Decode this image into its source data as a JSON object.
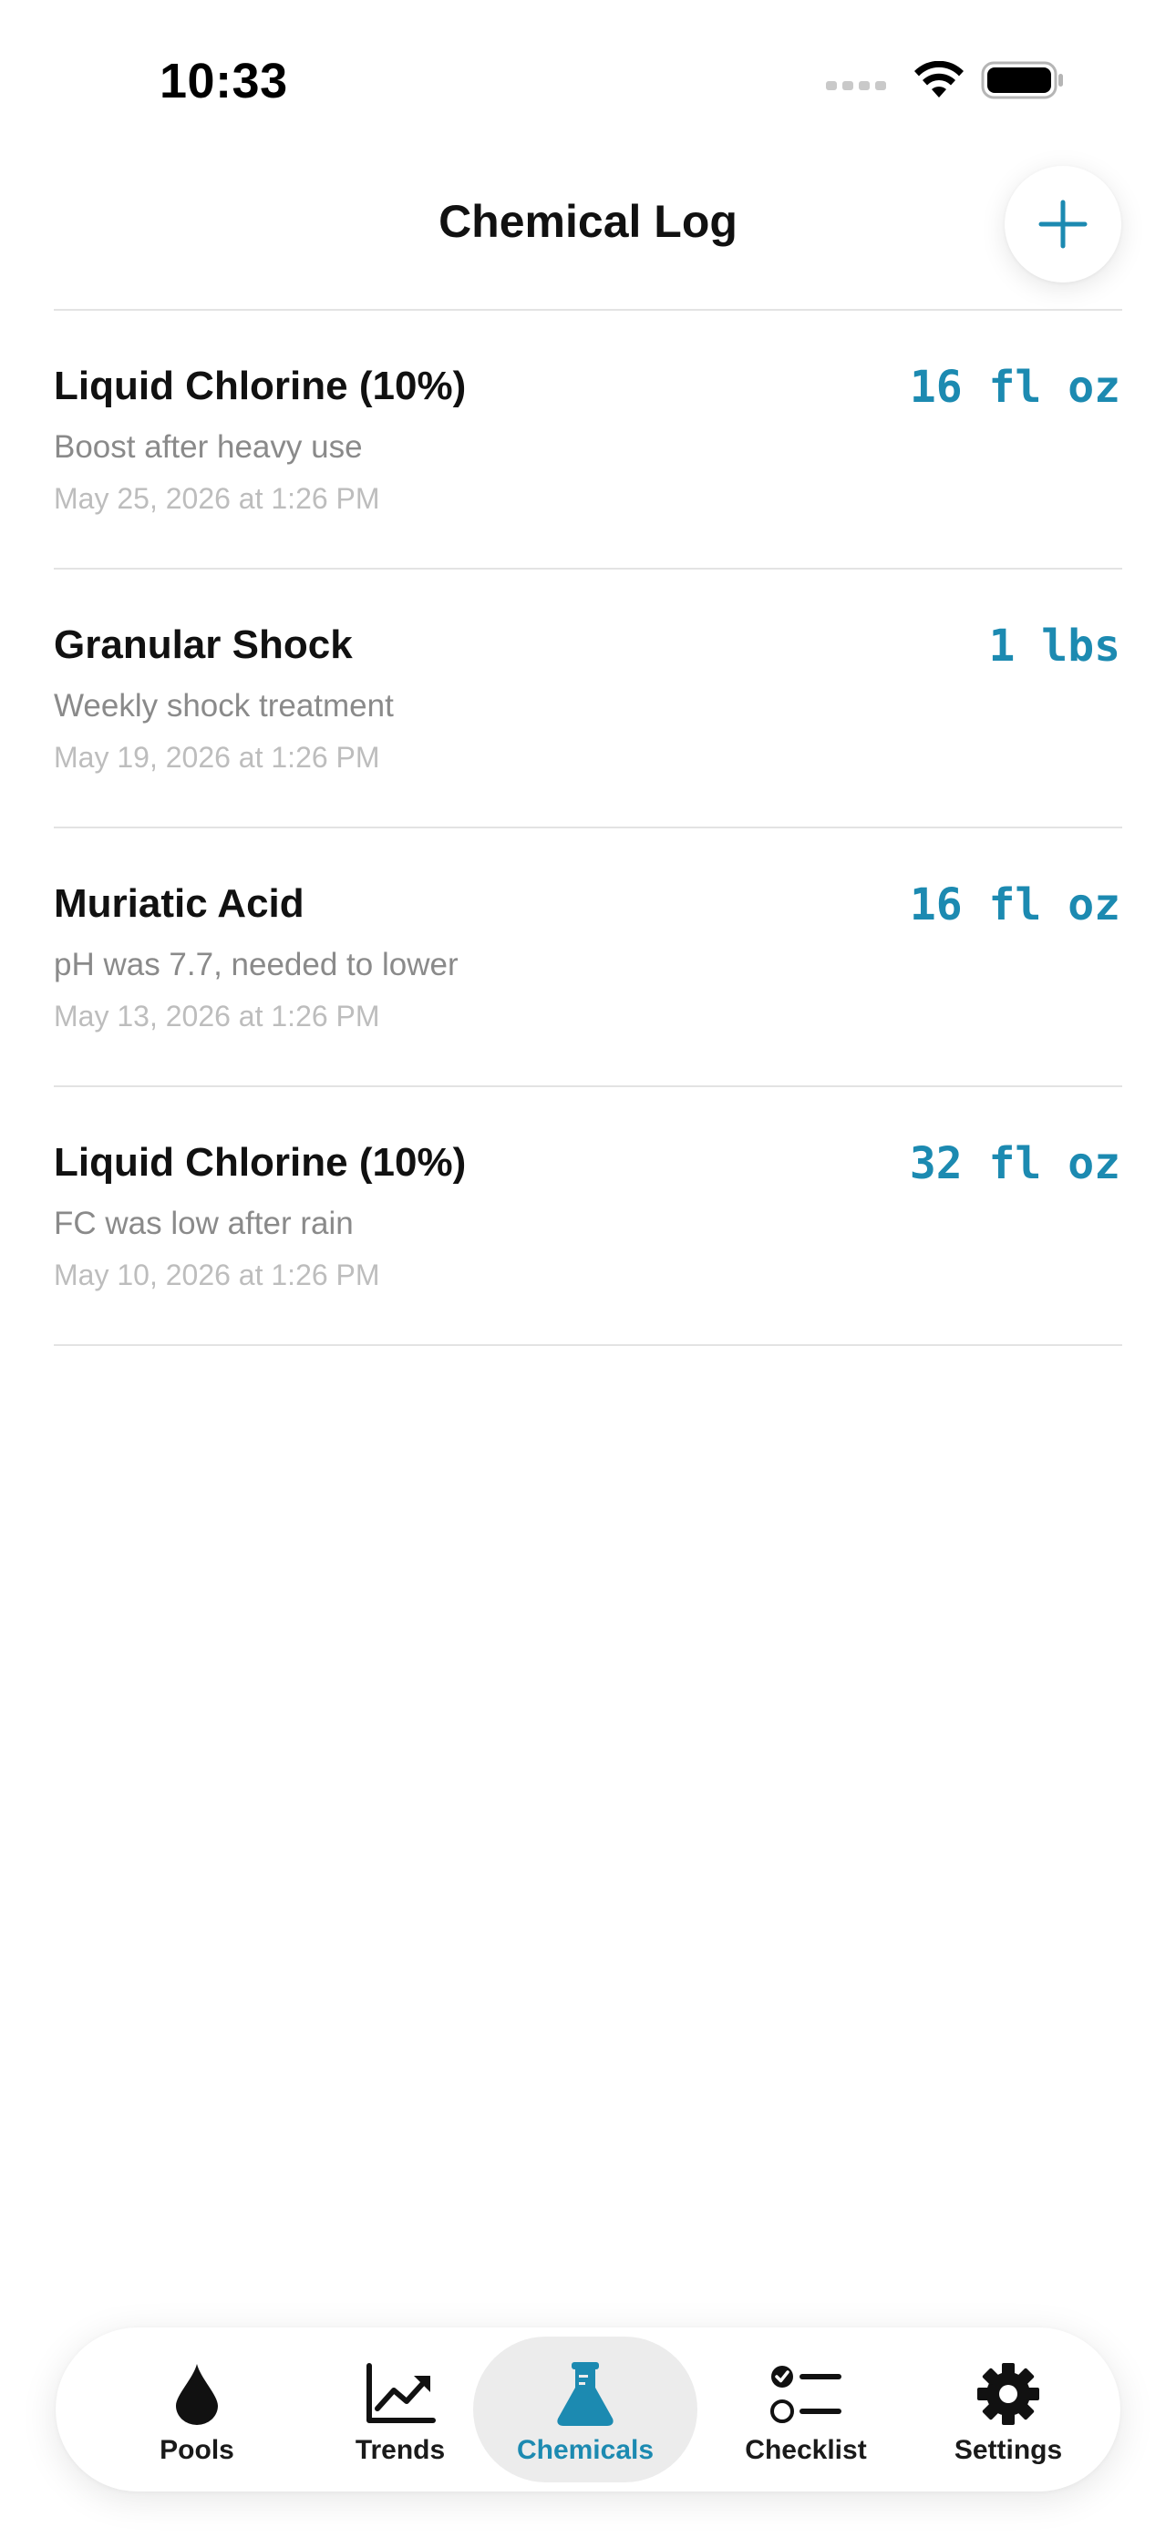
{
  "status_bar": {
    "time": "10:33"
  },
  "header": {
    "title": "Chemical Log",
    "add_icon": "plus-icon"
  },
  "colors": {
    "accent": "#1c8ab1",
    "note": "#8a8a8a",
    "date": "#bdbdbd",
    "divider": "#e3e3e3",
    "active_tab_bg": "#ececec"
  },
  "log_entries": [
    {
      "name": "Liquid Chlorine (10%)",
      "note": "Boost after heavy use",
      "date": "May 25, 2026 at 1:26 PM",
      "amount": "16 fl oz"
    },
    {
      "name": "Granular Shock",
      "note": "Weekly shock treatment",
      "date": "May 19, 2026 at 1:26 PM",
      "amount": "1 lbs"
    },
    {
      "name": "Muriatic Acid",
      "note": "pH was 7.7, needed to lower",
      "date": "May 13, 2026 at 1:26 PM",
      "amount": "16 fl oz"
    },
    {
      "name": "Liquid Chlorine (10%)",
      "note": "FC was low after rain",
      "date": "May 10, 2026 at 1:26 PM",
      "amount": "32 fl oz"
    }
  ],
  "tabs": [
    {
      "label": "Pools",
      "icon": "drop-icon",
      "active": false
    },
    {
      "label": "Trends",
      "icon": "chart-trend-icon",
      "active": false
    },
    {
      "label": "Chemicals",
      "icon": "flask-icon",
      "active": true
    },
    {
      "label": "Checklist",
      "icon": "checklist-icon",
      "active": false
    },
    {
      "label": "Settings",
      "icon": "gear-icon",
      "active": false
    }
  ]
}
